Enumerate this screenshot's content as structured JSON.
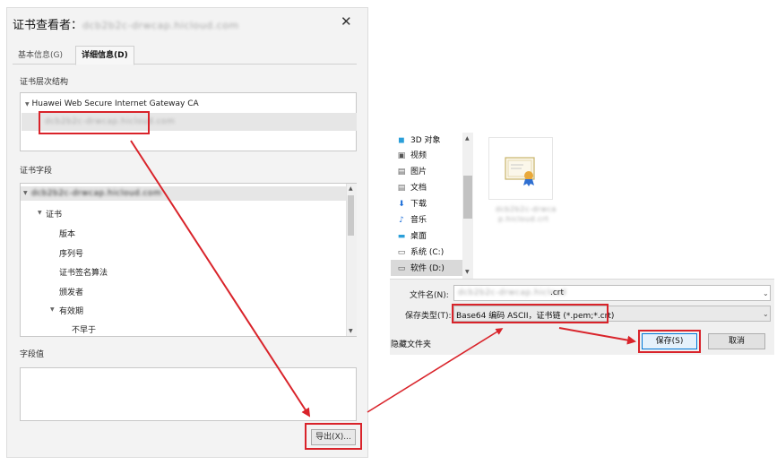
{
  "viewer": {
    "title_prefix": "证书查看者：",
    "title_domain": "dcb2b2c-drwcap.hicloud.com",
    "close": "✕",
    "tabs": {
      "basic": "基本信息(G)",
      "detail": "详细信息(D)"
    },
    "hierarchy_label": "证书层次结构",
    "hierarchy": {
      "root": "Huawei Web Secure Internet Gateway CA",
      "child": "dcb2b2c-drwcap.hicloud.com"
    },
    "fields_label": "证书字段",
    "fields": {
      "top": "dcb2b2c-drwcap.hicloud.com",
      "cert": "证书",
      "version": "版本",
      "serial": "序列号",
      "algorithm": "证书签名算法",
      "issuer": "颁发者",
      "validity": "有效期",
      "not_before": "不早于"
    },
    "value_label": "字段值",
    "export_button": "导出(X)..."
  },
  "save_dialog": {
    "nav_items": [
      {
        "icon": "cube-3d-icon",
        "label": "3D 对象"
      },
      {
        "icon": "video-icon",
        "label": "视频"
      },
      {
        "icon": "picture-icon",
        "label": "图片"
      },
      {
        "icon": "document-icon",
        "label": "文档"
      },
      {
        "icon": "download-icon",
        "label": "下载"
      },
      {
        "icon": "music-icon",
        "label": "音乐"
      },
      {
        "icon": "desktop-icon",
        "label": "桌面"
      },
      {
        "icon": "drive-icon",
        "label": "系统 (C:)"
      },
      {
        "icon": "drive-icon",
        "label": "软件 (D:)"
      }
    ],
    "file_label_line1": "dcb2b2c-drwca",
    "file_label_line2": "p.hicloud.crt",
    "filename_label": "文件名(N):",
    "filename_blurred": "dcb2b2c-drwcap.hicloud",
    "filename_ext": ".crt",
    "filetype_label": "保存类型(T):",
    "filetype_value": "Base64 编码 ASCII，证书链 (*.pem;*.crt)",
    "hide_folders": "隐藏文件夹",
    "save_button": "保存(S)",
    "cancel_button": "取消"
  },
  "colors": {
    "highlight": "#d9232a",
    "primary_border": "#0078d7"
  }
}
